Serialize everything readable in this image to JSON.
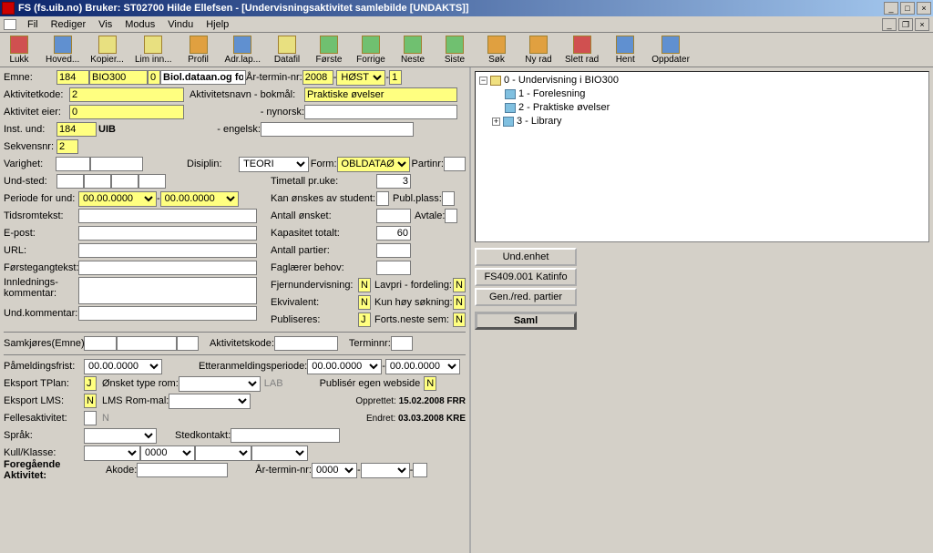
{
  "window": {
    "title": "FS (fs.uib.no) Bruker: ST02700 Hilde Ellefsen - [Undervisningsaktivitet samlebilde  [UNDAKTS]]"
  },
  "menu": {
    "fil": "Fil",
    "rediger": "Rediger",
    "vis": "Vis",
    "modus": "Modus",
    "vindu": "Vindu",
    "hjelp": "Hjelp"
  },
  "toolbar": {
    "lukk": "Lukk",
    "hoved": "Hoved...",
    "kopier": "Kopier...",
    "liminn": "Lim inn...",
    "profil": "Profil",
    "adrlap": "Adr.lap...",
    "datafil": "Datafil",
    "forste": "Første",
    "forrige": "Forrige",
    "neste": "Neste",
    "siste": "Siste",
    "sok": "Søk",
    "nyrad": "Ny rad",
    "slettrad": "Slett rad",
    "hent": "Hent",
    "oppdater": "Oppdater"
  },
  "form": {
    "emne_label": "Emne:",
    "emne1": "184",
    "emne2": "BIO300",
    "emne3": "0",
    "emne_navn": "Biol.dataan.og fo",
    "aar_label": "År-termin-nr:",
    "aar": "2008",
    "termin": "HØST",
    "nr": "1",
    "aktkode_label": "Aktivitetkode:",
    "aktkode": "2",
    "aktnavn_label": "Aktivitetsnavn  - bokmål:",
    "aktnavn_bok": "Praktiske øvelser",
    "akteier_label": "Aktivitet eier:",
    "akteier": "0",
    "nynorsk_label": "- nynorsk:",
    "engelsk_label": "- engelsk:",
    "instund_label": "Inst. und:",
    "instund1": "184",
    "instund2": "UIB",
    "sekvens_label": "Sekvensnr:",
    "sekvens": "2",
    "varighet_label": "Varighet:",
    "disiplin_label": "Disiplin:",
    "disiplin": "TEORI",
    "formlbl": "Form:",
    "formval": "OBLDATAØ",
    "partinr_label": "Partinr:",
    "undsted_label": "Und-sted:",
    "timetall_label": "Timetall pr.uke:",
    "timetall": "3",
    "periode_label": "Periode for und:",
    "p1": "00.00.0000",
    "p2": "00.00.0000",
    "kanonsk_label": "Kan ønskes av student:",
    "publplass_label": "Publ.plass:",
    "tidsrom_label": "Tidsromtekst:",
    "antonsk_label": "Antall ønsket:",
    "avtale_label": "Avtale:",
    "epost_label": "E-post:",
    "kap_label": "Kapasitet totalt:",
    "kap": "60",
    "url_label": "URL:",
    "antpart_label": "Antall partier:",
    "forstg_label": "Førstegangtekst:",
    "fagl_label": "Faglærer behov:",
    "innl_label": "Innlednings-",
    "komm_label": "kommentar:",
    "fjern_label": "Fjernundervisning:",
    "fjern": "N",
    "lavpri_label": "Lavpri - fordeling:",
    "lavpri": "N",
    "ekv_label": "Ekvivalent:",
    "ekv": "N",
    "kunhoy_label": "Kun høy søkning:",
    "kunhoy": "N",
    "publ_label": "Publiseres:",
    "publ": "J",
    "forts_label": "Forts.neste sem:",
    "forts": "N",
    "undkomm_label": "Und.kommentar:",
    "samkj_label": "Samkjøres(Emne):",
    "aktk2_label": "Aktivitetskode:",
    "termnr_label": "Terminnr:",
    "pam_label": "Påmeldingsfrist:",
    "pam": "00.00.0000",
    "ett_label": "Etteranmeldingsperiode:",
    "ett1": "00.00.0000",
    "ett2": "00.00.0000",
    "etp_label": "Eksport TPlan:",
    "etp": "J",
    "ots_label": "Ønsket type rom:",
    "lab": "LAB",
    "pew_label": "Publisér egen webside",
    "pew": "N",
    "elms_label": "Eksport LMS:",
    "elms": "N",
    "lmsrom_label": "LMS Rom-mal:",
    "opp_label": "Opprettet:",
    "opp": "15.02.2008  FRR",
    "end_label": "Endret:",
    "end": "03.03.2008  KRE",
    "fellles_label": "Fellesaktivitet:",
    "felles": "N",
    "sprak_label": "Språk:",
    "stedk_label": "Stedkontakt:",
    "kull_label": "Kull/Klasse:",
    "kull2": "0000",
    "foreg_label": "Foregående Aktivitet:",
    "akode_label": "Akode:",
    "aarterm2_label": "År-termin-nr:",
    "aarterm2": "0000"
  },
  "buttons": {
    "undenhet": "Und.enhet",
    "katinfo": "FS409.001 Katinfo",
    "genred": "Gen./red. partier",
    "saml": "Saml"
  },
  "tree": {
    "root": "0 - Undervisning i BIO300",
    "c1": "1 - Forelesning",
    "c2": "2 - Praktiske øvelser",
    "c3": "3 - Library"
  }
}
